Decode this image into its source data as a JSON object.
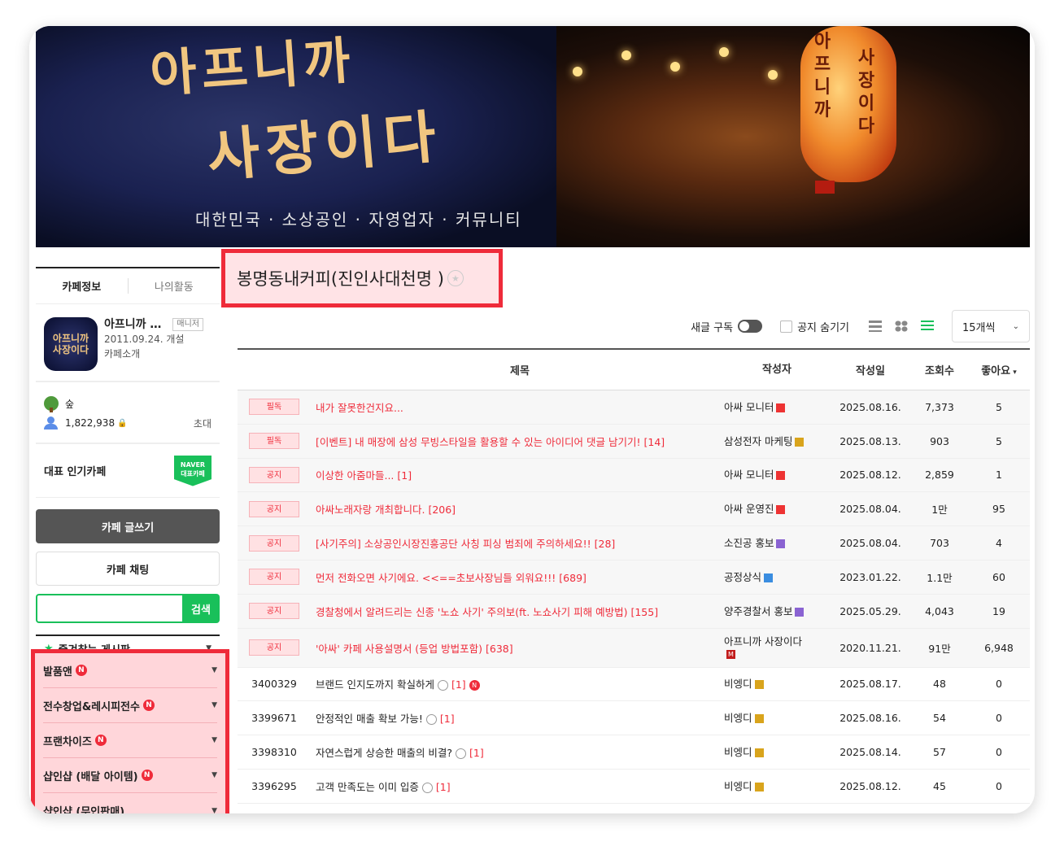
{
  "banner": {
    "title_line1": "아프니까",
    "title_line2": "사장이다",
    "subtitle": "대한민국 · 소상공인 · 자영업자 · 커뮤니티",
    "lantern_left": [
      "아",
      "프",
      "니",
      "까"
    ],
    "lantern_right": [
      "사",
      "장",
      "이",
      "다"
    ]
  },
  "sidebar": {
    "tabs": [
      "카페정보",
      "나의활동"
    ],
    "cafe": {
      "thumb_line1": "아프니까",
      "thumb_line2": "사장이다",
      "name": "아프니까 …",
      "manager_badge": "매니저",
      "founded": "2011.09.24. 개설",
      "intro": "카페소개"
    },
    "rank_label": "숲",
    "members": "1,822,938",
    "invite": "초대",
    "popular_label": "대표 인기카페",
    "naver_badge_line1": "NAVER",
    "naver_badge_line2": "대표카페",
    "write_button": "카페 글쓰기",
    "chat_button": "카페 채팅",
    "search_button": "검색",
    "favorites_label": "즐겨찾는 게시판",
    "boards": [
      {
        "label": "발품앤"
      },
      {
        "label": "전수창업&레시피전수"
      },
      {
        "label": "프랜차이즈"
      },
      {
        "label": "샵인샵 (배달 아이템)"
      },
      {
        "label": "샵인샵 (무인판매)"
      }
    ]
  },
  "main": {
    "board_title": "봉명동내커피(진인사대천명 )",
    "toolbar": {
      "subscribe_label": "새글 구독",
      "hide_notice_label": "공지 숨기기",
      "per_page": "15개씩"
    },
    "columns": {
      "title": "제목",
      "author": "작성자",
      "date": "작성일",
      "views": "조회수",
      "likes": "좋아요"
    },
    "rows": [
      {
        "num": "필독",
        "title": "내가 잘못한건지요...",
        "count": "",
        "author": "아싸 모니터",
        "level": "red",
        "date": "2025.08.16.",
        "views": "7,373",
        "likes": "5"
      },
      {
        "num": "필독",
        "title": "[이벤트] 내 매장에 삼성 무빙스타일을 활용할 수 있는 아이디어 댓글 남기기!",
        "count": "[14]",
        "author": "삼성전자 마케팅",
        "level": "gold",
        "date": "2025.08.13.",
        "views": "903",
        "likes": "5"
      },
      {
        "num": "공지",
        "title": "이상한 아줌마들...",
        "count": "[1]",
        "author": "아싸 모니터",
        "level": "red",
        "date": "2025.08.12.",
        "views": "2,859",
        "likes": "1"
      },
      {
        "num": "공지",
        "title": "아싸노래자랑 개최합니다.",
        "count": "[206]",
        "author": "아싸 운영진",
        "level": "red",
        "date": "2025.08.04.",
        "views": "1만",
        "likes": "95"
      },
      {
        "num": "공지",
        "title": "[사기주의] 소상공인시장진흥공단 사칭 피싱 범죄에 주의하세요!!",
        "count": "[28]",
        "author": "소진공 홍보",
        "level": "purple",
        "date": "2025.08.04.",
        "views": "703",
        "likes": "4"
      },
      {
        "num": "공지",
        "title": "먼저 전화오면 사기에요. <<==초보사장님들 외워요!!!",
        "count": "[689]",
        "author": "공정상식",
        "level": "blue",
        "date": "2023.01.22.",
        "views": "1.1만",
        "likes": "60"
      },
      {
        "num": "공지",
        "title": "경찰청에서 알려드리는 신종 '노쇼 사기' 주의보(ft. 노쇼사기 피해 예방법)",
        "count": "[155]",
        "author": "양주경찰서 홍보",
        "level": "purple",
        "date": "2025.05.29.",
        "views": "4,043",
        "likes": "19"
      },
      {
        "num": "공지",
        "title": "'아싸' 카페 사용설명서 (등업 방법포함)",
        "count": "[638]",
        "author": "아프니까 사장이다",
        "level": "m",
        "date": "2020.11.21.",
        "views": "91만",
        "likes": "6,948"
      },
      {
        "num": "3400329",
        "title": "브랜드 인지도까지 확실하게",
        "count": "[1]",
        "author": "비엥디",
        "level": "gold",
        "date": "2025.08.17.",
        "views": "48",
        "likes": "0"
      },
      {
        "num": "3399671",
        "title": "안정적인 매출 확보 가능!",
        "count": "[1]",
        "author": "비엥디",
        "level": "gold",
        "date": "2025.08.16.",
        "views": "54",
        "likes": "0"
      },
      {
        "num": "3398310",
        "title": "자연스럽게 상승한 매출의 비결?",
        "count": "[1]",
        "author": "비엥디",
        "level": "gold",
        "date": "2025.08.14.",
        "views": "57",
        "likes": "0"
      },
      {
        "num": "3396295",
        "title": "고객 만족도는 이미 입증",
        "count": "[1]",
        "author": "비엥디",
        "level": "gold",
        "date": "2025.08.12.",
        "views": "45",
        "likes": "0"
      }
    ]
  },
  "colors": {
    "accent_green": "#19c05a",
    "highlight_red": "#ef2b3a",
    "notice_red": "#ef2b3a"
  },
  "icons": {
    "subscribe": "toggle-icon",
    "views": [
      "list-view-icon",
      "grid-view-icon",
      "detail-view-icon"
    ]
  }
}
